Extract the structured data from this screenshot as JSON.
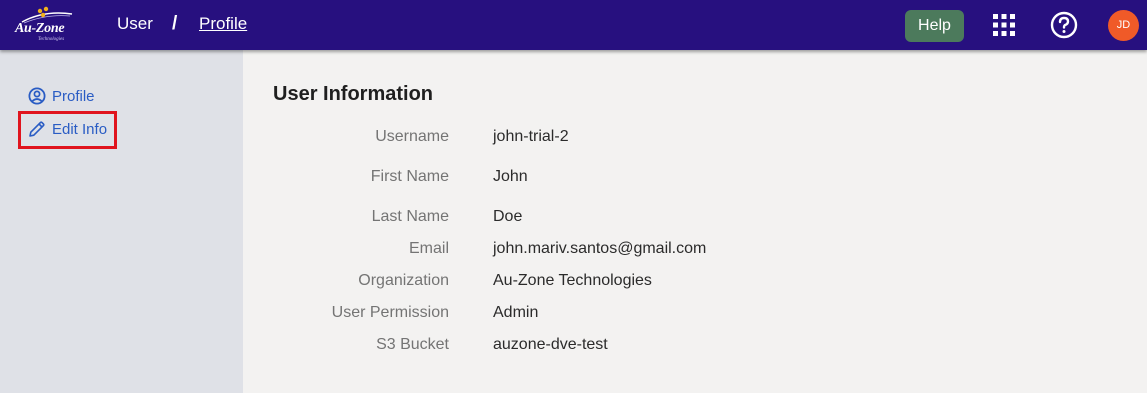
{
  "header": {
    "logo_text": "Au-Zone",
    "logo_subtext": "Technologies",
    "breadcrumb": {
      "section": "User",
      "separator": "/",
      "current": "Profile"
    },
    "help_label": "Help",
    "apps_icon": "apps-grid-icon",
    "help_icon": "question-circle-icon",
    "avatar_initials": "JD",
    "colors": {
      "bar": "#27107f",
      "help_button": "#4c7a5c",
      "avatar": "#f05a28"
    }
  },
  "sidebar": {
    "items": [
      {
        "label": "Profile",
        "icon": "user-circle-icon"
      },
      {
        "label": "Edit Info",
        "icon": "pencil-icon"
      }
    ],
    "colors": {
      "background": "#dfe1e7",
      "link": "#2a5cc4",
      "highlight": "#e0141e"
    }
  },
  "main": {
    "title": "User Information",
    "fields": [
      {
        "label": "Username",
        "value": "john-trial-2"
      },
      {
        "label": "First Name",
        "value": "John"
      },
      {
        "label": "Last Name",
        "value": "Doe"
      },
      {
        "label": "Email",
        "value": "john.mariv.santos@gmail.com"
      },
      {
        "label": "Organization",
        "value": "Au-Zone Technologies"
      },
      {
        "label": "User Permission",
        "value": "Admin"
      },
      {
        "label": "S3 Bucket",
        "value": "auzone-dve-test"
      }
    ]
  }
}
